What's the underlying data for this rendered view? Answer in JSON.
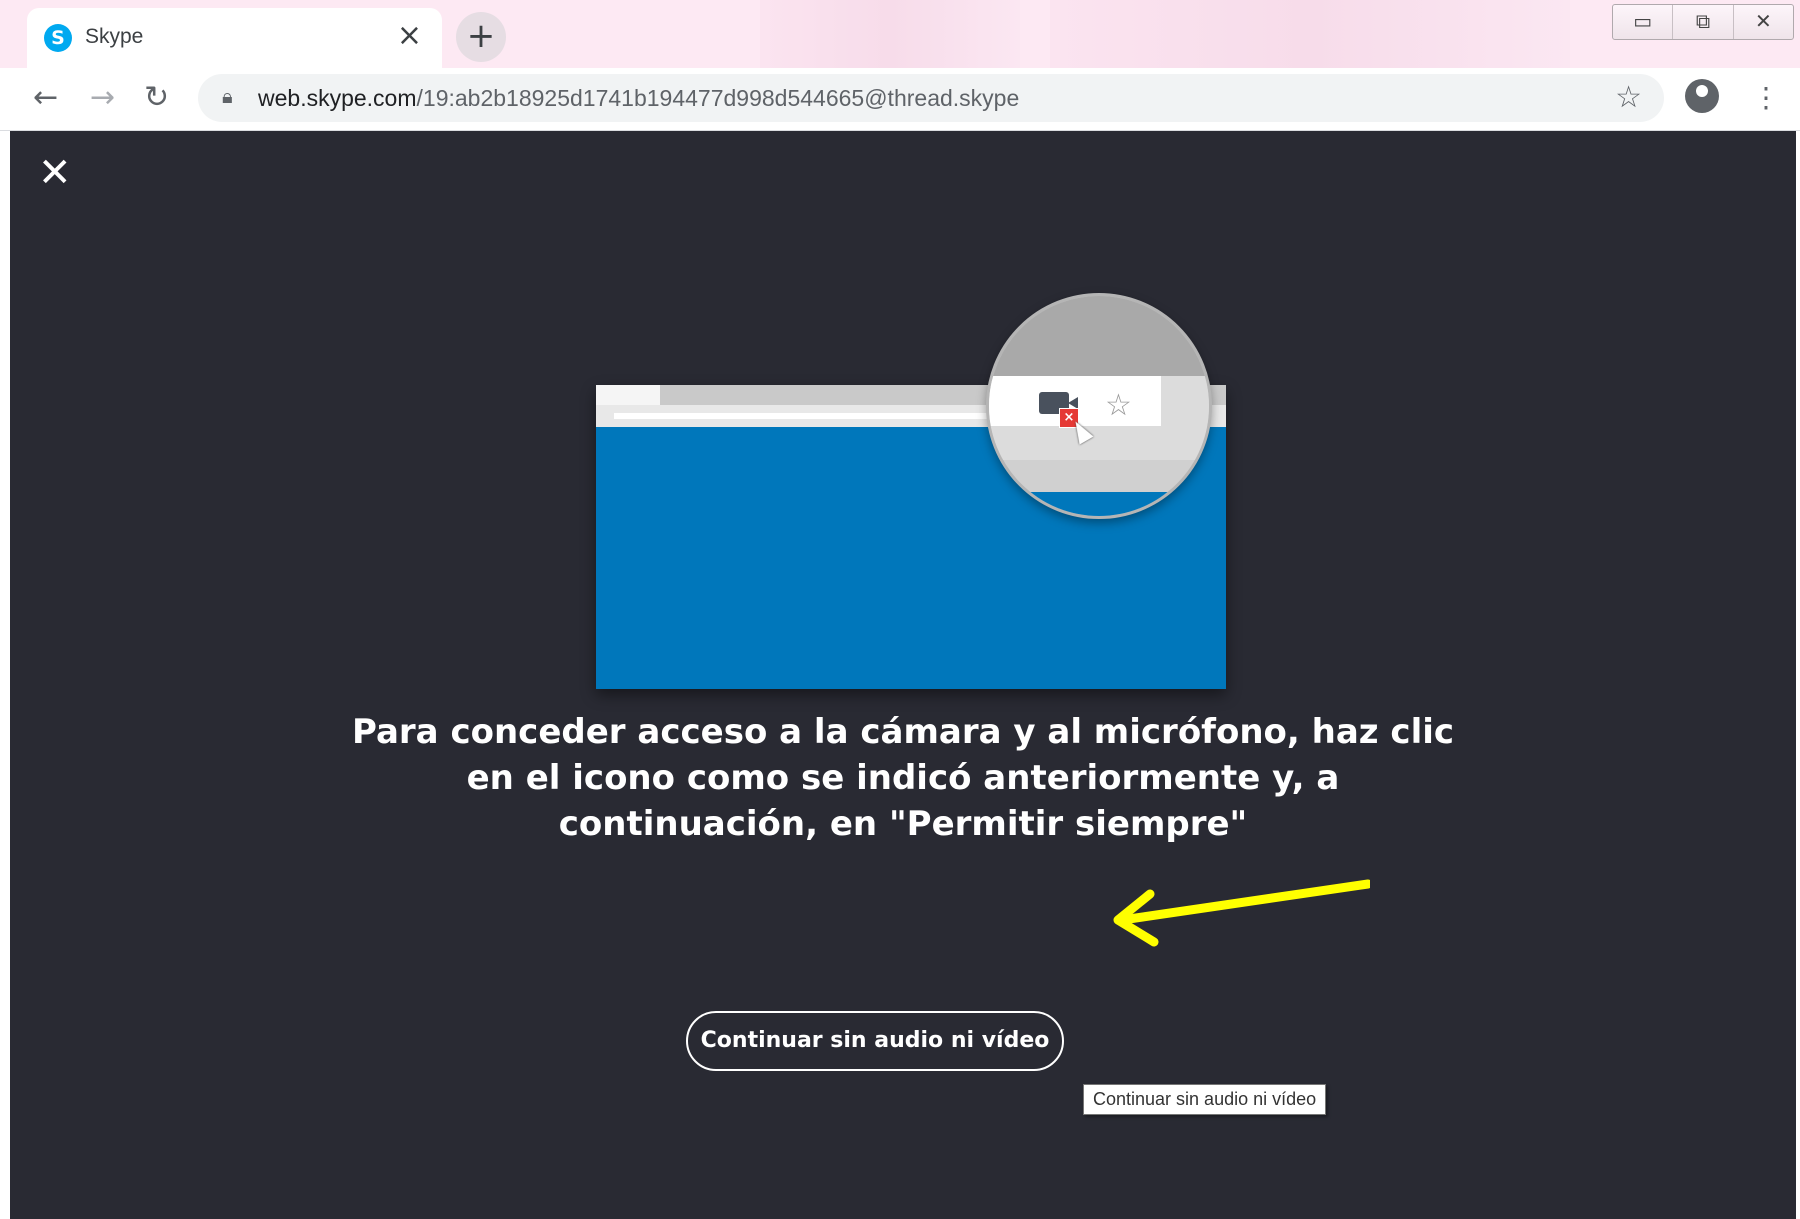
{
  "browser": {
    "tab": {
      "title": "Skype",
      "icon": "skype-logo-icon",
      "icon_letter": "S",
      "close_glyph": "×"
    },
    "new_tab_glyph": "+",
    "window_controls": {
      "minimize": "▭",
      "restore": "⧉",
      "close": "✕"
    },
    "address": {
      "host": "web.skype.com",
      "path": "/19:ab2b18925d1741b194477d998d544665@thread.skype"
    },
    "colors": {
      "tab_icon": "#00a9f0",
      "page_background": "#292a33",
      "illustration_blue": "#0077bb"
    }
  },
  "page": {
    "close_glyph": "✕",
    "message": "Para conceder acceso a la cámara y al micrófono, haz clic en el icono como se indicó anteriormente y, a continuación, en \"Permitir siempre\"",
    "continue_button": "Continuar sin audio ni vídeo",
    "tooltip": "Continuar sin audio ni vídeo",
    "annotation_arrow_color": "#ffff00"
  }
}
